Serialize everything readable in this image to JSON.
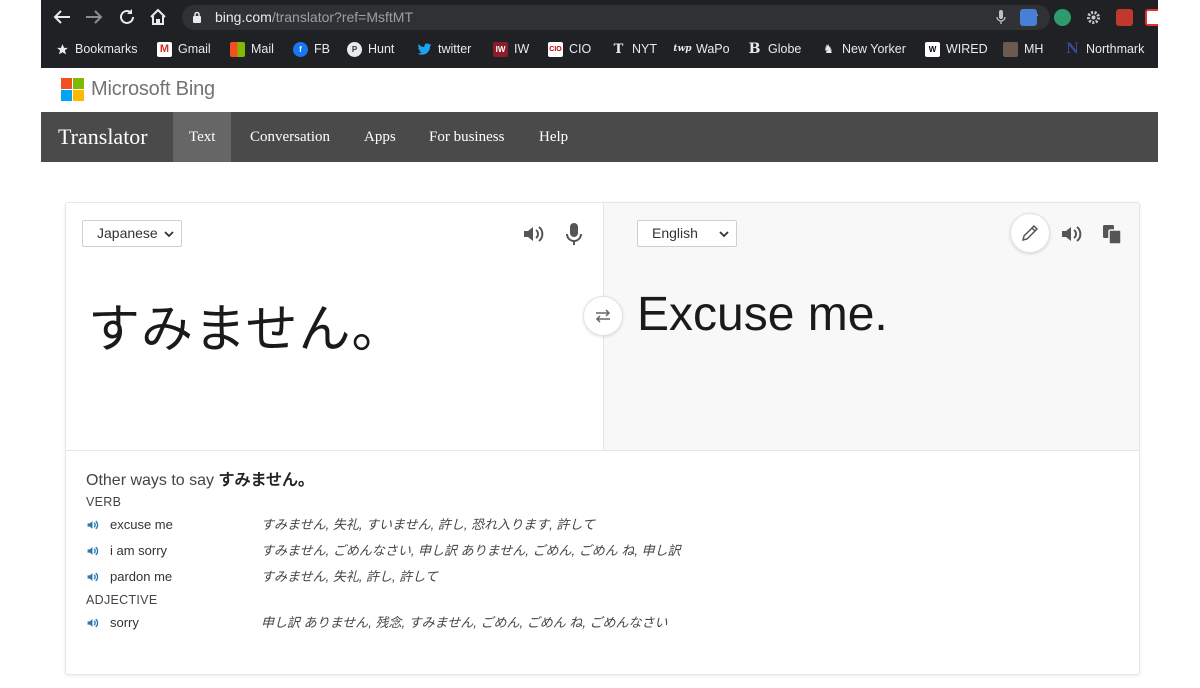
{
  "browser": {
    "url_host": "bing.com",
    "url_path": "/translator?ref=MsftMT",
    "bookmarks": [
      {
        "label": "Bookmarks",
        "icon": "star-icon"
      },
      {
        "label": "Gmail",
        "icon": "gmail-icon"
      },
      {
        "label": "Mail",
        "icon": "microsoft-mail-icon"
      },
      {
        "label": "FB",
        "icon": "facebook-icon"
      },
      {
        "label": "Hunt",
        "icon": "product-hunt-icon"
      },
      {
        "label": "twitter",
        "icon": "twitter-icon"
      },
      {
        "label": "IW",
        "icon": "iw-icon"
      },
      {
        "label": "CIO",
        "icon": "cio-icon"
      },
      {
        "label": "NYT",
        "icon": "nyt-icon"
      },
      {
        "label": "WaPo",
        "icon": "wapo-icon"
      },
      {
        "label": "Globe",
        "icon": "globe-newspaper-icon"
      },
      {
        "label": "New Yorker",
        "icon": "new-yorker-icon"
      },
      {
        "label": "WIRED",
        "icon": "wired-icon"
      },
      {
        "label": "MH",
        "icon": "mh-icon"
      },
      {
        "label": "Northmark",
        "icon": "northmark-icon"
      }
    ]
  },
  "header": {
    "brand": "Microsoft Bing"
  },
  "nav": {
    "title": "Translator",
    "items": [
      "Text",
      "Conversation",
      "Apps",
      "For business",
      "Help"
    ],
    "active": "Text"
  },
  "translator": {
    "source_language": "Japanese",
    "target_language": "English",
    "source_text": "すみません。",
    "translated_text": "Excuse me."
  },
  "other_ways": {
    "title_prefix": "Other ways to say",
    "title_term": "すみません。",
    "groups": [
      {
        "pos": "VERB",
        "entries": [
          {
            "word": "excuse me",
            "back": "すみません, 失礼, すいません, 許し, 恐れ入ります, 許して"
          },
          {
            "word": "i am sorry",
            "back": "すみません, ごめんなさい, 申し訳 ありません, ごめん, ごめん ね, 申し訳"
          },
          {
            "word": "pardon me",
            "back": "すみません, 失礼, 許し, 許して"
          }
        ]
      },
      {
        "pos": "ADJECTIVE",
        "entries": [
          {
            "word": "sorry",
            "back": "申し訳 ありません, 残念, すみません, ごめん, ごめん ね, ごめんなさい"
          }
        ]
      }
    ]
  },
  "colors": {
    "chrome_bg": "#202124",
    "nav_bg": "#4a4a4a",
    "nav_active": "#666666",
    "speaker_blue": "#2a7ab0"
  }
}
